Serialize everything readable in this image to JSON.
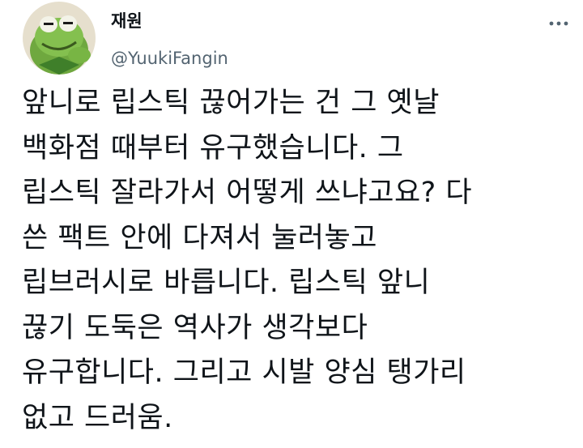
{
  "tweet": {
    "author": {
      "display_name": "재원",
      "handle": "@YuukiFangin",
      "avatar_icon": "kermit-frog-avatar"
    },
    "more_icon": "more-dots-icon",
    "lines": [
      "앞니로 립스틱 끊어가는 건 그 옛날",
      "백화점 때부터 유구했습니다. 그",
      "립스틱 잘라가서 어떻게 쓰냐고요? 다",
      "쓴 팩트 안에 다져서 눌러놓고",
      "립브러시로 바릅니다. 립스틱 앞니",
      "끊기 도둑은 역사가 생각보다",
      "유구합니다. 그리고 시발 양심 탱가리",
      "없고 드러움."
    ]
  },
  "colors": {
    "text_primary": "#0f1419",
    "text_secondary": "#536471",
    "icon": "#536471",
    "avatar_green": "#7ab648",
    "avatar_bg": "#e8e0d0"
  }
}
